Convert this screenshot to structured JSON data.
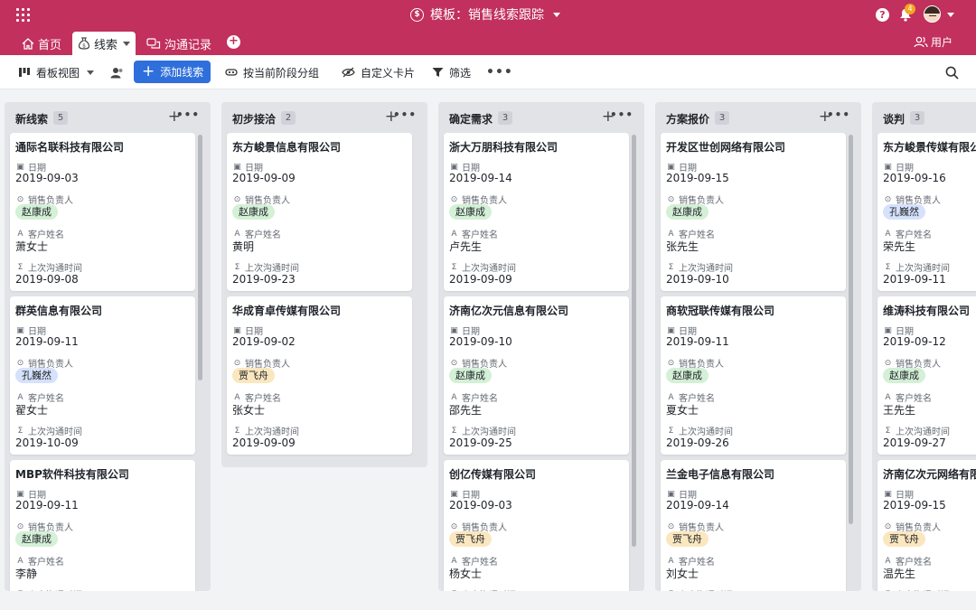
{
  "app": {
    "title": "模板：销售线索跟踪",
    "notification_count": "4",
    "help_label": "?"
  },
  "tabs": [
    {
      "label": "首页",
      "icon": "home-icon"
    },
    {
      "label": "线索",
      "icon": "money-bag-icon"
    },
    {
      "label": "沟通记录",
      "icon": "chat-icon"
    }
  ],
  "users_label": "用户",
  "toolbar": {
    "view_label": "看板视图",
    "add_label": "添加线索",
    "group_label": "按当前阶段分组",
    "card_label": "自定义卡片",
    "filter_label": "筛选",
    "more_label": "•••"
  },
  "fields": {
    "date": "日期",
    "owner": "销售负责人",
    "customer": "客户姓名",
    "last_contact": "上次沟通时间"
  },
  "colors": {
    "brand": "#c2305d",
    "primary_button": "#2f6fdb",
    "tag_zhao": "#d4f0d6",
    "tag_kong": "#d6e2fb",
    "tag_jia": "#fbe7bf"
  },
  "columns": [
    {
      "name": "新线索",
      "count": "5",
      "cards": [
        {
          "title": "通际名联科技有限公司",
          "date": "2019-09-03",
          "owner": "赵康成",
          "customer": "萧女士",
          "last": "2019-09-08"
        },
        {
          "title": "群英信息有限公司",
          "date": "2019-09-11",
          "owner": "孔巍然",
          "customer": "翟女士",
          "last": "2019-10-09"
        },
        {
          "title": "MBP软件科技有限公司",
          "date": "2019-09-11",
          "owner": "赵康成",
          "customer": "李静",
          "last": ""
        }
      ]
    },
    {
      "name": "初步接洽",
      "count": "2",
      "cards": [
        {
          "title": "东方峻景信息有限公司",
          "date": "2019-09-09",
          "owner": "赵康成",
          "customer": "黄明",
          "last": "2019-09-23"
        },
        {
          "title": "华成育卓传媒有限公司",
          "date": "2019-09-02",
          "owner": "贾飞舟",
          "customer": "张女士",
          "last": "2019-09-09"
        }
      ]
    },
    {
      "name": "确定需求",
      "count": "3",
      "cards": [
        {
          "title": "浙大万朋科技有限公司",
          "date": "2019-09-14",
          "owner": "赵康成",
          "customer": "卢先生",
          "last": "2019-09-09"
        },
        {
          "title": "济南亿次元信息有限公司",
          "date": "2019-09-10",
          "owner": "赵康成",
          "customer": "邵先生",
          "last": "2019-09-25"
        },
        {
          "title": "创亿传媒有限公司",
          "date": "2019-09-03",
          "owner": "贾飞舟",
          "customer": "杨女士",
          "last": ""
        }
      ]
    },
    {
      "name": "方案报价",
      "count": "3",
      "cards": [
        {
          "title": "开发区世创网络有限公司",
          "date": "2019-09-15",
          "owner": "赵康成",
          "customer": "张先生",
          "last": "2019-09-10"
        },
        {
          "title": "商软冠联传媒有限公司",
          "date": "2019-09-11",
          "owner": "赵康成",
          "customer": "夏女士",
          "last": "2019-09-26"
        },
        {
          "title": "兰金电子信息有限公司",
          "date": "2019-09-14",
          "owner": "贾飞舟",
          "customer": "刘女士",
          "last": ""
        }
      ]
    },
    {
      "name": "谈判",
      "count": "3",
      "cards": [
        {
          "title": "东方峻景传媒有限公司",
          "date": "2019-09-16",
          "owner": "孔巍然",
          "customer": "荣先生",
          "last": "2019-09-11"
        },
        {
          "title": "维涛科技有限公司",
          "date": "2019-09-12",
          "owner": "赵康成",
          "customer": "王先生",
          "last": "2019-09-27"
        },
        {
          "title": "济南亿次元网络有限公司",
          "date": "2019-09-15",
          "owner": "贾飞舟",
          "customer": "温先生",
          "last": ""
        }
      ]
    }
  ]
}
